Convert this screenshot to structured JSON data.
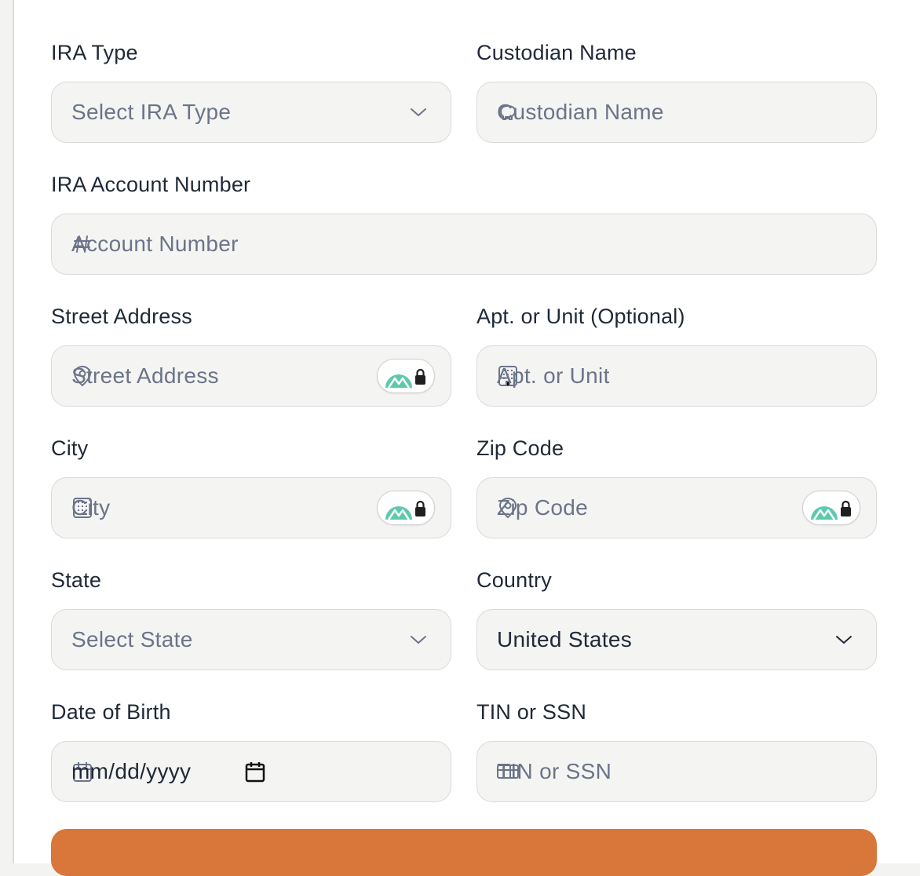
{
  "form": {
    "ira_type": {
      "label": "IRA Type",
      "placeholder": "Select IRA Type"
    },
    "custodian_name": {
      "label": "Custodian Name",
      "placeholder": "Custodian Name"
    },
    "account_number": {
      "label": "IRA Account Number",
      "placeholder": "Account Number"
    },
    "street_address": {
      "label": "Street Address",
      "placeholder": "Street Address"
    },
    "apt_unit": {
      "label": "Apt. or Unit (Optional)",
      "placeholder": "Apt. or Unit"
    },
    "city": {
      "label": "City",
      "placeholder": "City"
    },
    "zip_code": {
      "label": "Zip Code",
      "placeholder": "Zip Code"
    },
    "state": {
      "label": "State",
      "placeholder": "Select State"
    },
    "country": {
      "label": "Country",
      "value": "United States"
    },
    "date_of_birth": {
      "label": "Date of Birth",
      "placeholder": "mm/dd/yyyy"
    },
    "tin_ssn": {
      "label": "TIN or SSN",
      "placeholder": "TIN or SSN"
    }
  },
  "icons": {
    "custodian": "piggy-bank-icon",
    "account": "hash-icon",
    "street": "map-pin-icon",
    "apt": "building-icon",
    "city": "city-icon",
    "zip": "map-pin-icon",
    "dob": "calendar-icon",
    "tin": "id-card-icon",
    "password_manager": "password-manager-lock-icon"
  },
  "colors": {
    "accent_button": "#d9773a",
    "badge_teal": "#5cc9ad",
    "placeholder": "#6b7488",
    "label": "#1f2937",
    "field_bg": "#f4f4f3"
  }
}
